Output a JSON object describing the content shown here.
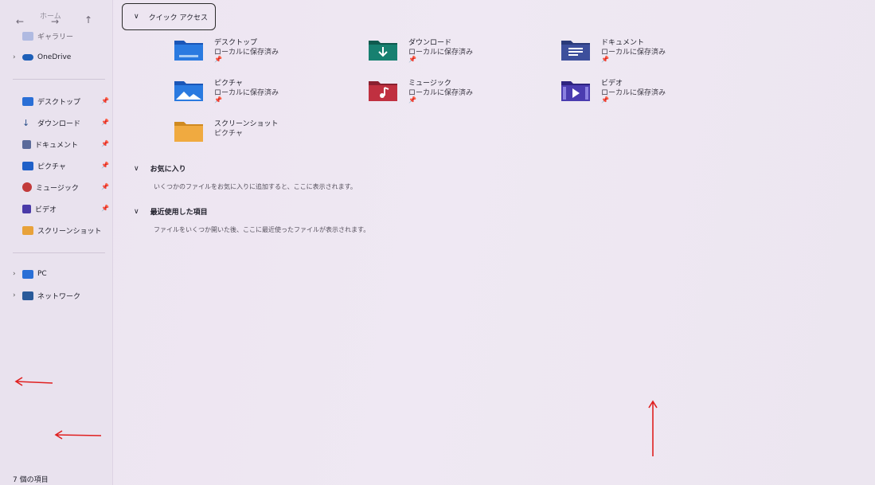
{
  "nav": {
    "back": "←",
    "forward": "→",
    "up": "↑"
  },
  "sidebar": {
    "top_items": [
      {
        "label": "ホーム",
        "icon": "home-icon"
      },
      {
        "label": "ギャラリー",
        "icon": "gallery-icon"
      },
      {
        "label": "OneDrive",
        "icon": "cloud-icon"
      }
    ],
    "pinned": [
      {
        "label": "デスクトップ",
        "icon": "desktop-icon"
      },
      {
        "label": "ダウンロード",
        "icon": "download-icon"
      },
      {
        "label": "ドキュメント",
        "icon": "document-icon"
      },
      {
        "label": "ピクチャ",
        "icon": "picture-icon"
      },
      {
        "label": "ミュージック",
        "icon": "music-icon"
      },
      {
        "label": "ビデオ",
        "icon": "video-icon"
      },
      {
        "label": "スクリーンショット",
        "icon": "folder-icon"
      }
    ],
    "devices": [
      {
        "label": "PC",
        "icon": "pc-icon"
      },
      {
        "label": "ネットワーク",
        "icon": "network-icon"
      }
    ]
  },
  "quick_access": {
    "title": "クイック アクセス",
    "items": [
      {
        "name": "デスクトップ",
        "sub": "ローカルに保存済み",
        "pinned": "📌",
        "icon": "desktop-folder-icon"
      },
      {
        "name": "ダウンロード",
        "sub": "ローカルに保存済み",
        "pinned": "📌",
        "icon": "download-folder-icon"
      },
      {
        "name": "ドキュメント",
        "sub": "ローカルに保存済み",
        "pinned": "📌",
        "icon": "document-folder-icon"
      },
      {
        "name": "ピクチャ",
        "sub": "ローカルに保存済み",
        "pinned": "📌",
        "icon": "picture-folder-icon"
      },
      {
        "name": "ミュージック",
        "sub": "ローカルに保存済み",
        "pinned": "📌",
        "icon": "music-folder-icon"
      },
      {
        "name": "ビデオ",
        "sub": "ローカルに保存済み",
        "pinned": "📌",
        "icon": "video-folder-icon"
      },
      {
        "name": "スクリーンショット",
        "sub": "ピクチャ",
        "pinned": "",
        "icon": "screenshot-folder-icon"
      }
    ]
  },
  "favorites": {
    "title": "お気に入り",
    "desc": "いくつかのファイルをお気に入りに追加すると、ここに表示されます。"
  },
  "recent": {
    "title": "最近使用した項目",
    "desc": "ファイルをいくつか開いた後、ここに最近使ったファイルが表示されます。"
  },
  "status": {
    "count": "7 個の項目"
  },
  "chevrons": {
    "collapse": "∨",
    "expand": "›"
  },
  "colors": {
    "accent": "#2a6fd6",
    "annotation_arrow": "#e02020"
  }
}
